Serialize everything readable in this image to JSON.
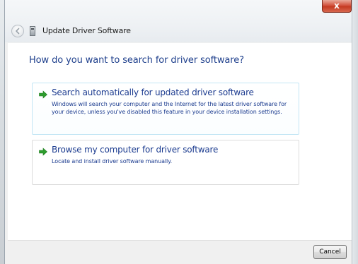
{
  "window": {
    "title": "Update Driver Software",
    "close_label": "x"
  },
  "main": {
    "heading": "How do you want to search for driver software?",
    "options": [
      {
        "title": "Search automatically for updated driver software",
        "description": "Windows will search your computer and the Internet for the latest driver software for your device, unless you've disabled this feature in your device installation settings.",
        "icon": "green-arrow-icon"
      },
      {
        "title": "Browse my computer for driver software",
        "description": "Locate and install driver software manually.",
        "icon": "green-arrow-icon"
      }
    ]
  },
  "footer": {
    "cancel_label": "Cancel"
  },
  "colors": {
    "link_blue": "#1b3b8f",
    "arrow_green": "#2e9d2e",
    "option_highlight_border": "#c3e6f5"
  }
}
